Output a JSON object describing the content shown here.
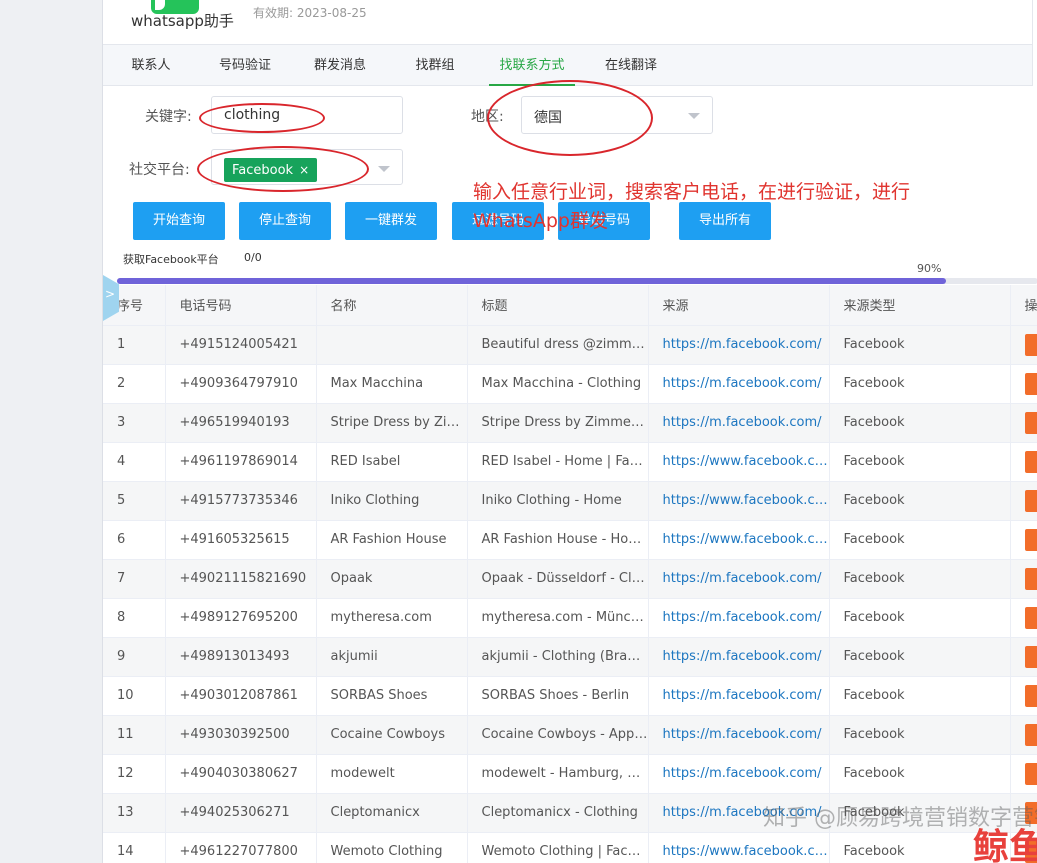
{
  "app": {
    "title": "whatsapp助手",
    "expiry": "有效期: 2023-08-25"
  },
  "tabs": [
    "联系人",
    "号码验证",
    "群发消息",
    "找群组",
    "找联系方式",
    "在线翻译"
  ],
  "form": {
    "keyword_label": "关键字:",
    "keyword_value": "clothing",
    "region_label": "地区:",
    "region_value": "德国",
    "platform_label": "社交平台:",
    "platform_tag": "Facebook",
    "tag_close": "×"
  },
  "annotation": "输入任意行业词，搜索客户电话，在进行验证，进行WhatsApp群发",
  "buttons": [
    "开始查询",
    "停止查询",
    "一键群发",
    "过滤号码",
    "导出号码",
    "导出所有"
  ],
  "status": {
    "label": "获取Facebook平台",
    "count": "0/0",
    "progress_text": "90%",
    "progress": 90
  },
  "side_tab": ">",
  "table": {
    "headers": [
      "序号",
      "电话号码",
      "名称",
      "标题",
      "来源",
      "来源类型",
      "操作"
    ],
    "rows": [
      [
        "1",
        "+4915124005421",
        "",
        "Beautiful dress @zimmermann",
        "https://m.facebook.com/",
        "Facebook"
      ],
      [
        "2",
        "+4909364797910",
        "Max Macchina",
        "Max Macchina - Clothing",
        "https://m.facebook.com/",
        "Facebook"
      ],
      [
        "3",
        "+496519940193",
        "Stripe Dress by Zimmermann",
        "Stripe Dress by Zimmermann",
        "https://m.facebook.com/",
        "Facebook"
      ],
      [
        "4",
        "+4961197869014",
        "RED Isabel",
        "RED Isabel - Home | Facebook",
        "https://www.facebook.com/",
        "Facebook"
      ],
      [
        "5",
        "+4915773735346",
        "Iniko Clothing",
        "Iniko Clothing - Home",
        "https://www.facebook.com/",
        "Facebook"
      ],
      [
        "6",
        "+491605325615",
        "AR Fashion House",
        "AR Fashion House - Home",
        "https://www.facebook.com/",
        "Facebook"
      ],
      [
        "7",
        "+49021115821690",
        "Opaak",
        "Opaak - Düsseldorf - Clothing",
        "https://m.facebook.com/",
        "Facebook"
      ],
      [
        "8",
        "+4989127695200",
        "mytheresa.com",
        "mytheresa.com - München",
        "https://m.facebook.com/",
        "Facebook"
      ],
      [
        "9",
        "+498913013493",
        "akjumii",
        "akjumii - Clothing (Brand)",
        "https://m.facebook.com/",
        "Facebook"
      ],
      [
        "10",
        "+4903012087861",
        "SORBAS Shoes",
        "SORBAS Shoes - Berlin",
        "https://m.facebook.com/",
        "Facebook"
      ],
      [
        "11",
        "+493030392500",
        "Cocaine Cowboys",
        "Cocaine Cowboys - Apparel",
        "https://m.facebook.com/",
        "Facebook"
      ],
      [
        "12",
        "+4904030380627",
        "modewelt",
        "modewelt - Hamburg, Germany",
        "https://m.facebook.com/",
        "Facebook"
      ],
      [
        "13",
        "+494025306271",
        "Cleptomanicx",
        "Cleptomanicx - Clothing",
        "https://m.facebook.com/",
        "Facebook"
      ],
      [
        "14",
        "+4961227077800",
        "Wemoto Clothing",
        "Wemoto Clothing | Facebook",
        "https://www.facebook.com/",
        "Facebook"
      ]
    ]
  },
  "watermark": "知乎 @顾易跨境营销数字营销",
  "watermark_logo": "鲸鱼",
  "colors": {
    "tab_active": "#28a745",
    "button": "#1e9ff2",
    "tag": "#17a35b",
    "link": "#1c76c0",
    "annotation": "#e0342f",
    "progress": "#6f63d9"
  }
}
